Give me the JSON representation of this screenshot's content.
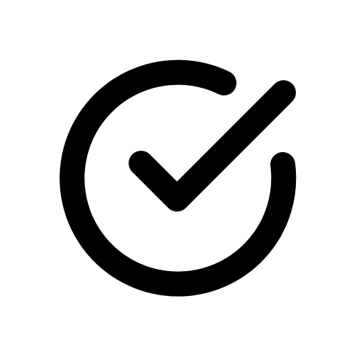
{
  "icon": {
    "name": "check-circle-icon",
    "stroke_color": "#000000",
    "background_color": "#ffffff"
  }
}
